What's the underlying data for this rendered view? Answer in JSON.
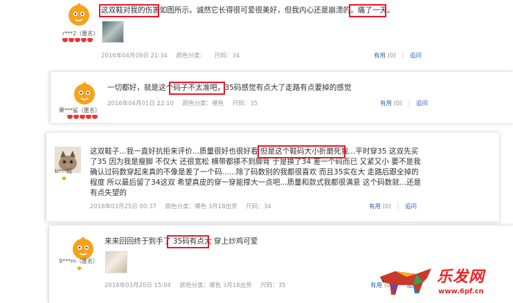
{
  "reviews": [
    {
      "username": "r***2（匿名）",
      "text": "这双鞋对我的伤害如图所示。诚然它长得很可爱很美好，但我内心还是崩溃的。痛了一天。",
      "date": "2016年04月09日 21:34",
      "color": "颜色分类：",
      "size": "尺码：34",
      "useful": "有用",
      "useful_count": "(0)",
      "reply": "追问"
    },
    {
      "username": "果***鲨（匿名）",
      "text": "一切都好，就是这个码子不太准吧，35码感觉有点大了走路有点要掉的感觉",
      "date": "2016年04月01日 22:10",
      "color": "颜色分类：裸色",
      "size": "尺码：35",
      "useful": "有用",
      "useful_count": "(0)",
      "reply": "追问"
    },
    {
      "username": "b***糕",
      "text_lines": [
        "这双鞋子...我一直好抗拒来评价...质量很好也很好看 但是这个鞋码大小折磨死我...平时穿35 这双先买",
        "了35 因为我是瘦脚 不仅大 还很宽松 横带都搽不到脚背 于是换了34 差一个码而已 又紧又小 要不是我",
        "确认过码数穿起来真的不像是差了一个码......除了码数别的我都很喜欢 而且35实在大 走路后跟全掉的",
        "程度 所以最后留了34这双 希望真皮的穿一穿能撑大一点吧...质量和款式我都很满意 这个码数就...还是",
        "有点失望的"
      ],
      "date": "2016年03月25日 00:37",
      "color": "颜色分类：裸色 3月18出货",
      "size": "尺码：34",
      "useful": "有用",
      "useful_count": "(0)",
      "reply": "追问"
    },
    {
      "username": "9***m（匿名）",
      "text": "来来回回终于到手了 35码有点大 穿上炒鸡可爱",
      "date": "2016年03月20日 15:04",
      "color": "颜色分类：裸色 3月18出货",
      "size": "尺码：35",
      "useful": "有用",
      "useful_count": "(0)",
      "reply": "追问"
    }
  ],
  "watermark": {
    "title": "乐发网",
    "url": "www.6pf.cn"
  },
  "colors": {
    "highlight": "#e11122",
    "link": "#2a62b8",
    "meta": "#999999",
    "avatar": "#f7a21b"
  }
}
